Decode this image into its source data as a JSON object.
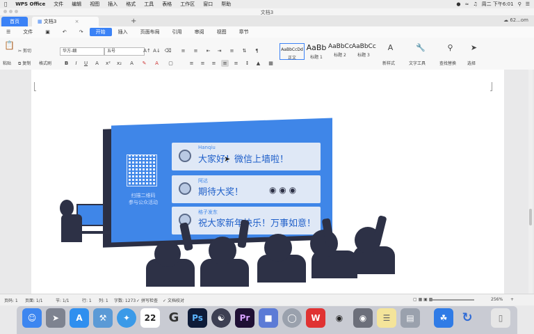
{
  "menubar": {
    "items": [
      "WPS Office",
      "文件",
      "编辑",
      "视图",
      "插入",
      "格式",
      "工具",
      "表格",
      "工作区",
      "窗口",
      "帮助"
    ],
    "clock": "周二 下午6:01"
  },
  "window": {
    "title": "文档3"
  },
  "tabs": {
    "home": "首页",
    "doc": "文档3",
    "add": "+",
    "cloud": "62...om"
  },
  "menu": {
    "items": [
      "文件",
      "开始",
      "插入",
      "页面布局",
      "引用",
      "审阅",
      "视图",
      "章节"
    ],
    "active_index": 1
  },
  "ribbon": {
    "cut": "剪切",
    "copy": "复制",
    "format_painter": "格式刷",
    "paste": "粘贴",
    "font": "华方-细",
    "size": "五号",
    "styles": [
      {
        "preview": "AaBbCcDd",
        "label": "正文"
      },
      {
        "preview": "AaBb",
        "label": "标题 1"
      },
      {
        "preview": "AaBbCc",
        "label": "标题 2"
      },
      {
        "preview": "AaBbCc",
        "label": "标题 3"
      }
    ],
    "new_style": "新样式",
    "text_tools": "文字工具",
    "find_replace": "查找替换",
    "select": "选择"
  },
  "illustration": {
    "qr_caption": [
      "扫描二维码",
      "参与公众活动"
    ],
    "messages": [
      {
        "name": "Hanqiu",
        "text": "大家好！微信上墙啦！"
      },
      {
        "name": "阿达",
        "text": "期待大奖！"
      },
      {
        "name": "格子发东",
        "text": "祝大家新年快乐！万事如意！"
      }
    ]
  },
  "status": {
    "page": "页码: 1",
    "pages": "页面: 1/1",
    "section": "节: 1/1",
    "row": "行: 1",
    "col": "列: 1",
    "words": "字数: 1273",
    "spell": "拼写检查",
    "doc_check": "文档校对",
    "zoom": "256%"
  },
  "dock": {
    "calendar_day": "22",
    "apps": [
      "finder-icon",
      "rocket-icon",
      "appstore-icon",
      "xcode-icon",
      "safari-icon",
      "calendar-icon",
      "g-icon",
      "ps-icon",
      "pr-helper-icon",
      "premiere-icon",
      "keynote-icon",
      "chrome-icon",
      "wps-icon",
      "qq-icon",
      "wechat-icon",
      "notes-icon",
      "books-icon",
      "baidu-icon",
      "edge-icon",
      "trash-icon"
    ]
  }
}
